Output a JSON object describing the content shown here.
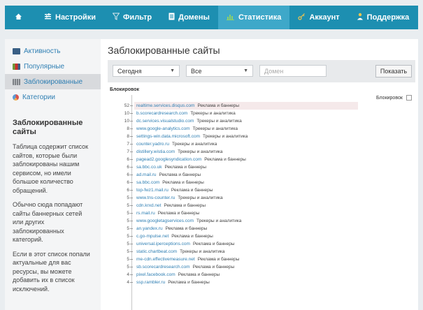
{
  "nav": {
    "items": [
      {
        "label": "",
        "icon": "home-icon"
      },
      {
        "label": "Настройки",
        "icon": "settings-icon"
      },
      {
        "label": "Фильтр",
        "icon": "filter-icon"
      },
      {
        "label": "Домены",
        "icon": "document-icon"
      },
      {
        "label": "Статистика",
        "icon": "chart-icon",
        "active": true
      },
      {
        "label": "Аккаунт",
        "icon": "key-icon"
      },
      {
        "label": "Поддержка",
        "icon": "person-icon"
      }
    ]
  },
  "sidebar": {
    "items": [
      {
        "label": "Активность",
        "icon": "activity-icon",
        "color": "#3a5f85"
      },
      {
        "label": "Популярные",
        "icon": "popular-chart-icon",
        "color": "#6f9a3a"
      },
      {
        "label": "Заблокированные",
        "icon": "blocked-chart-icon",
        "color": "#8a8d92",
        "active": true
      },
      {
        "label": "Категории",
        "icon": "pie-chart-icon",
        "color": "#d9534f"
      }
    ],
    "help": {
      "title": "Заблокированные сайты",
      "p1": "Таблица содержит список сайтов, которые были заблокированы нашим сервисом, но имели большое количество обращений.",
      "p2": "Обычно сюда попадают сайты баннерных сетей или других заблокированных категорий.",
      "p3": "Если в этот список попали актуальные для вас ресурсы, вы можете добавить их в список исключений."
    }
  },
  "main": {
    "title": "Заблокированные сайты",
    "filters": {
      "period": "Сегодня",
      "scope": "Все",
      "domain_placeholder": "Домен",
      "show_button": "Показать"
    },
    "list_header": "Блокировок",
    "legend_label": "Блокировок",
    "rows": [
      {
        "count": "52",
        "domain": "realtime.services.disqus.com",
        "category": "Реклама и баннеры"
      },
      {
        "count": "10",
        "domain": "b.scorecardresearch.com",
        "category": "Трекеры и аналитика"
      },
      {
        "count": "10",
        "domain": "dc.services.visualstudio.com",
        "category": "Трекеры и аналитика"
      },
      {
        "count": "8",
        "domain": "www.google-analytics.com",
        "category": "Трекеры и аналитика"
      },
      {
        "count": "8",
        "domain": "settings-win.data.microsoft.com",
        "category": "Трекеры и аналитика"
      },
      {
        "count": "7",
        "domain": "counter.yadro.ru",
        "category": "Трекеры и аналитика"
      },
      {
        "count": "7",
        "domain": "distillery.wistia.com",
        "category": "Трекеры и аналитика"
      },
      {
        "count": "6",
        "domain": "pagead2.googlesyndication.com",
        "category": "Реклама и баннеры"
      },
      {
        "count": "6",
        "domain": "sa.bbc.co.uk",
        "category": "Реклама и баннеры"
      },
      {
        "count": "6",
        "domain": "ad.mail.ru",
        "category": "Реклама и баннеры"
      },
      {
        "count": "6",
        "domain": "sa.bbc.com",
        "category": "Реклама и баннеры"
      },
      {
        "count": "6",
        "domain": "top-fwz1.mail.ru",
        "category": "Реклама и баннеры"
      },
      {
        "count": "5",
        "domain": "www.tns-counter.ru",
        "category": "Трекеры и аналитика"
      },
      {
        "count": "5",
        "domain": "cdn.krxd.net",
        "category": "Реклама и баннеры"
      },
      {
        "count": "5",
        "domain": "rs.mail.ru",
        "category": "Реклама и баннеры"
      },
      {
        "count": "5",
        "domain": "www.googletagservices.com",
        "category": "Трекеры и аналитика"
      },
      {
        "count": "5",
        "domain": "an.yandex.ru",
        "category": "Реклама и баннеры"
      },
      {
        "count": "5",
        "domain": "c.go-mpulse.net",
        "category": "Реклама и баннеры"
      },
      {
        "count": "5",
        "domain": "universal.iperceptions.com",
        "category": "Реклама и баннеры"
      },
      {
        "count": "5",
        "domain": "static.chartbeat.com",
        "category": "Трекеры и аналитика"
      },
      {
        "count": "5",
        "domain": "me-cdn.effectivemeasure.net",
        "category": "Реклама и баннеры"
      },
      {
        "count": "5",
        "domain": "sb.scorecardresearch.com",
        "category": "Реклама и баннеры"
      },
      {
        "count": "4",
        "domain": "pixel.facebook.com",
        "category": "Реклама и баннеры"
      },
      {
        "count": "4",
        "domain": "ssp.rambler.ru",
        "category": "Реклама и баннеры"
      }
    ]
  }
}
